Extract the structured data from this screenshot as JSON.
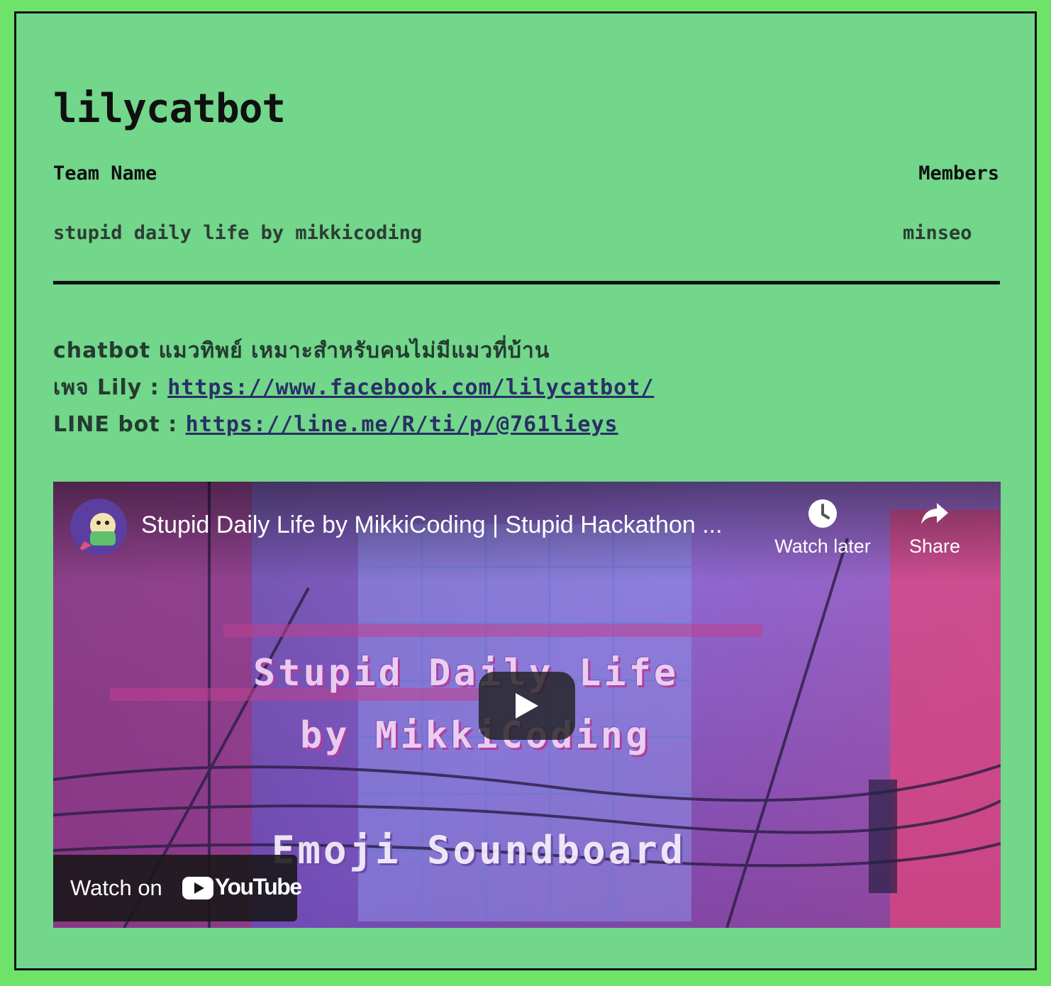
{
  "page": {
    "title": "lilycatbot"
  },
  "team": {
    "name_header": "Team Name",
    "members_header": "Members",
    "name": "stupid daily life by mikkicoding",
    "members": "minseo"
  },
  "description": {
    "line1": "chatbot แมวทิพย์ เหมาะสำหรับคนไม่มีแมวที่บ้าน",
    "facebook_label": "เพจ Lily : ",
    "facebook_url": "https://www.facebook.com/lilycatbot/",
    "line_label": "LINE bot : ",
    "line_url": "https://line.me/R/ti/p/@761lieys"
  },
  "video": {
    "title": "Stupid Daily Life by MikkiCoding | Stupid Hackathon ...",
    "watch_later": "Watch later",
    "share": "Share",
    "watch_on": "Watch on",
    "youtube": "YouTube",
    "thumbnail_line1": "Stupid Daily Life",
    "thumbnail_line2": "by MikkiCoding",
    "thumbnail_line3": "Emoji Soundboard",
    "icons": {
      "watch_later": "clock-icon",
      "share": "share-arrow-icon",
      "play": "play-icon",
      "youtube": "youtube-logo-icon"
    }
  },
  "colors": {
    "page_bg": "#6fe26a",
    "card_bg": "#72d68b",
    "text_dark": "#101010",
    "link": "#2a2f66"
  }
}
